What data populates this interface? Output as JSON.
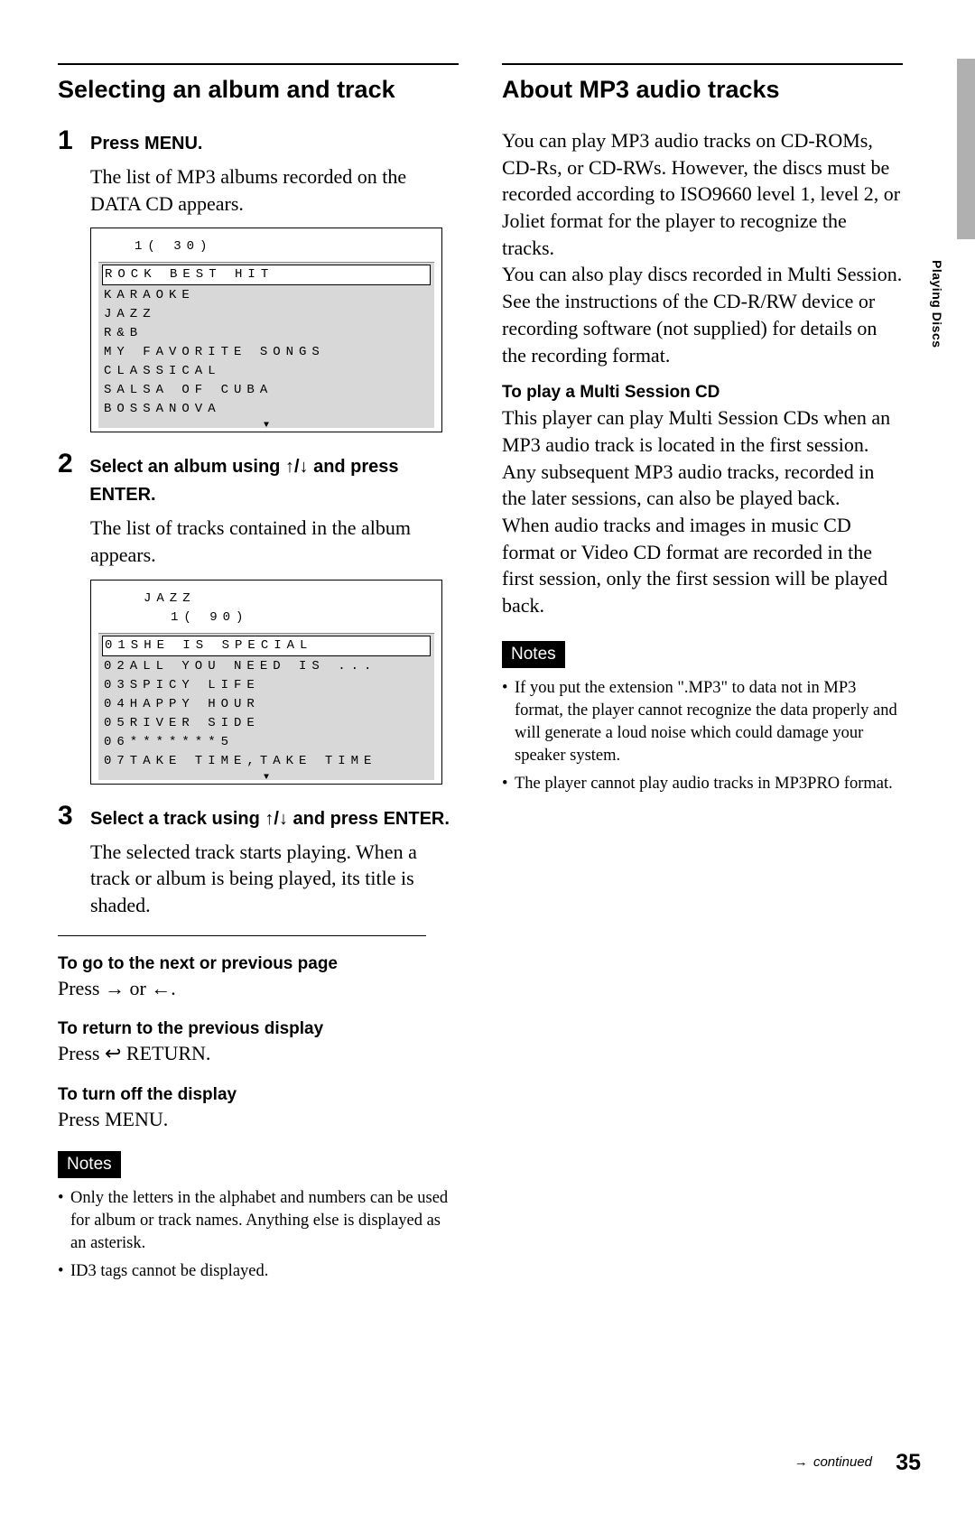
{
  "left": {
    "heading": "Selecting an album and track",
    "step1": {
      "num": "1",
      "title": "Press MENU.",
      "body": "The list of MP3 albums recorded on the DATA CD appears.",
      "screen": {
        "header": "1( 30)",
        "selected": "ROCK BEST HIT",
        "items": [
          "KARAOKE",
          "JAZZ",
          "R&B",
          "MY FAVORITE SONGS",
          "CLASSICAL",
          "SALSA OF CUBA",
          "BOSSANOVA"
        ],
        "more": "▼"
      }
    },
    "step2": {
      "num": "2",
      "title_pre": "Select an album using ",
      "title_mid": "/",
      "title_post": " and press ENTER.",
      "up": "↑",
      "down": "↓",
      "body": "The list of tracks contained in the album appears.",
      "screen": {
        "title": "JAZZ",
        "header": "1( 90)",
        "selected": "01SHE IS SPECIAL",
        "items": [
          "02ALL YOU NEED IS ...",
          "03SPICY LIFE",
          "04HAPPY HOUR",
          "05RIVER SIDE",
          "06*******5",
          "07TAKE TIME,TAKE TIME"
        ],
        "more": "▼"
      }
    },
    "step3": {
      "num": "3",
      "title_pre": "Select a track using ",
      "title_mid": "/",
      "title_post": " and press ENTER.",
      "up": "↑",
      "down": "↓",
      "body": "The selected track starts playing. When a track or album is being played, its title is shaded."
    },
    "nav1_h": "To go to the next or previous page",
    "nav1_b_pre": "Press ",
    "nav1_b_mid": " or ",
    "nav1_b_post": ".",
    "nav1_right": "→",
    "nav1_left": "←",
    "nav2_h": "To return to the previous display",
    "nav2_b_pre": "Press ",
    "nav2_icon": "↩",
    "nav2_b_post": " RETURN.",
    "nav3_h": "To turn off the display",
    "nav3_b": "Press MENU.",
    "notes_label": "Notes",
    "notes": [
      "Only the letters in the alphabet and numbers can be used for album or track names. Anything else is displayed as an asterisk.",
      "ID3 tags cannot be displayed."
    ]
  },
  "right": {
    "heading": "About MP3 audio tracks",
    "para": "You can play MP3 audio tracks on CD-ROMs, CD-Rs, or CD-RWs. However, the discs must be recorded according to ISO9660 level 1, level 2, or Joliet format for the player to recognize the tracks.\nYou can also play discs recorded in Multi Session.\nSee the instructions of the CD-R/RW device or recording software (not supplied) for details on the recording format.",
    "ms_h": "To play a Multi Session CD",
    "ms_b": "This player can play Multi Session CDs when an MP3 audio track is located in the first session. Any subsequent MP3 audio tracks, recorded in the later sessions, can also be played back.\nWhen audio tracks and images in music CD format or Video CD format are recorded in the first session, only the first session will be played back.",
    "notes_label": "Notes",
    "notes": [
      "If you put the extension \".MP3\" to data not in MP3 format, the player cannot recognize the data properly and will generate a loud noise which could damage your speaker system.",
      "The player cannot play audio tracks in MP3PRO format."
    ]
  },
  "side_tab": "Playing Discs",
  "footer": {
    "arrow": "→",
    "continued": "continued",
    "page": "35"
  }
}
